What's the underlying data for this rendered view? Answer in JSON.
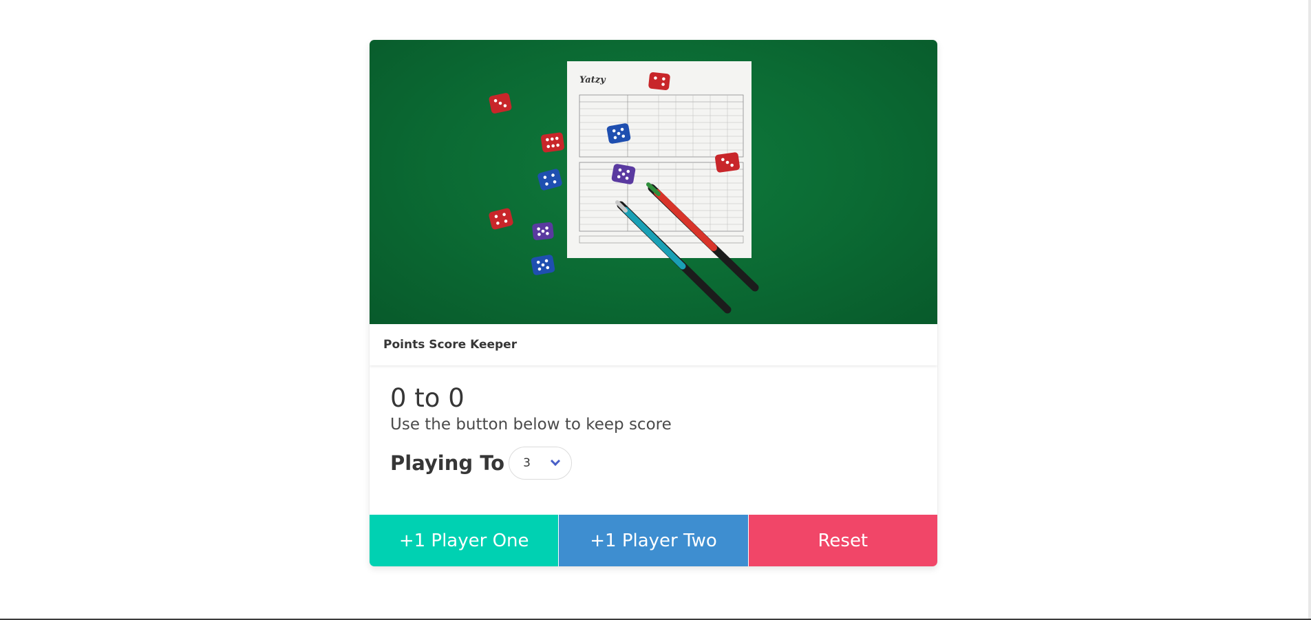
{
  "card": {
    "header_title": "Points Score Keeper",
    "score_title": "0 to 0",
    "subtitle": "Use the button below to keep score",
    "playing_to_label": "Playing To",
    "playing_to_value": "3"
  },
  "footer": {
    "player_one_label": "+1 Player One",
    "player_two_label": "+1 Player Two",
    "reset_label": "Reset"
  },
  "image": {
    "scoresheet_title": "Yatzy"
  },
  "colors": {
    "player_one": "#00d1b2",
    "player_two": "#3e8ed0",
    "reset": "#f14668",
    "felt": "#0b6a33",
    "chevron": "#485fc7"
  }
}
